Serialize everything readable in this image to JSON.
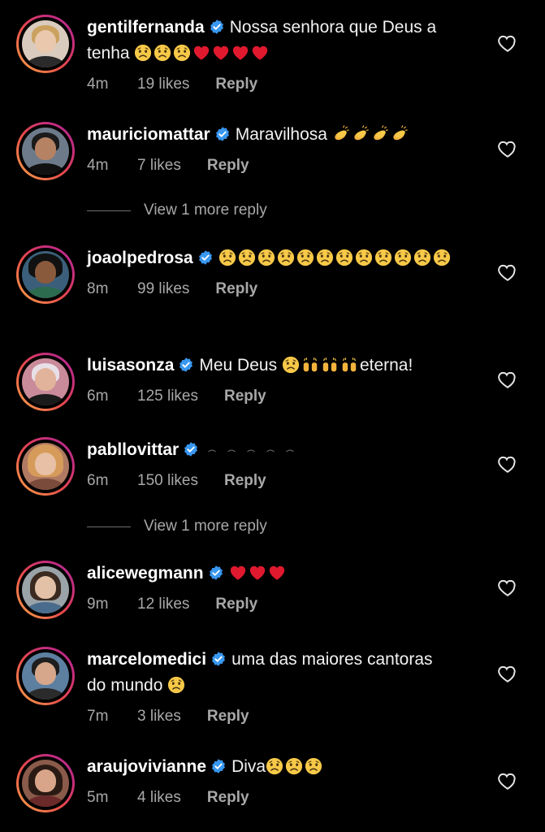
{
  "colors": {
    "background": "#000000",
    "text": "#f5f5f5",
    "meta": "#a8a8a8",
    "verified": "#3897f0",
    "heart_red": "#e0192e",
    "ring_gradient": [
      "#f9a94a",
      "#e8484b",
      "#c72d7d",
      "#b12a94"
    ]
  },
  "comments": [
    {
      "username": "gentilfernanda",
      "verified": true,
      "text_a": "Nossa senhora que Deus a",
      "text_b": "tenha",
      "emojis_after": [
        "sad-face-emoji",
        "sad-face-emoji",
        "sad-face-emoji",
        "red-heart-emoji",
        "red-heart-emoji",
        "red-heart-emoji",
        "red-heart-emoji"
      ],
      "time": "4m",
      "likes": "19 likes",
      "reply": "Reply",
      "avatar_icon": "avatar-photo"
    },
    {
      "username": "mauriciomattar",
      "verified": true,
      "text_a": "Maravilhosa",
      "emojis_after": [
        "clapping-hands-emoji",
        "clapping-hands-emoji",
        "clapping-hands-emoji",
        "clapping-hands-emoji"
      ],
      "time": "4m",
      "likes": "7 likes",
      "reply": "Reply",
      "avatar_icon": "avatar-photo"
    },
    {
      "username": "joaolpedrosa",
      "verified": true,
      "text_a": "",
      "emojis_after": [
        "sad-face-emoji",
        "sad-face-emoji",
        "sad-face-emoji",
        "sad-face-emoji",
        "sad-face-emoji",
        "sad-face-emoji",
        "sad-face-emoji",
        "sad-face-emoji",
        "sad-face-emoji",
        "sad-face-emoji",
        "sad-face-emoji",
        "sad-face-emoji"
      ],
      "time": "8m",
      "likes": "99 likes",
      "reply": "Reply",
      "avatar_icon": "avatar-photo"
    },
    {
      "username": "luisasonza",
      "verified": true,
      "text_a": "Meu Deus",
      "text_b": "eterna!",
      "emojis_after": [
        "sad-face-emoji",
        "raised-hands-emoji",
        "raised-hands-emoji",
        "raised-hands-emoji"
      ],
      "time": "6m",
      "likes": "125 likes",
      "reply": "Reply",
      "avatar_icon": "avatar-photo"
    },
    {
      "username": "pabllovittar",
      "verified": true,
      "text_a": "",
      "emojis_after": [
        "faded-emoji",
        "faded-emoji",
        "faded-emoji",
        "faded-emoji",
        "faded-emoji"
      ],
      "time": "6m",
      "likes": "150 likes",
      "reply": "Reply",
      "avatar_icon": "avatar-photo"
    },
    {
      "username": "alicewegmann",
      "verified": true,
      "text_a": "",
      "emojis_after": [
        "red-heart-emoji",
        "red-heart-emoji",
        "red-heart-emoji"
      ],
      "time": "9m",
      "likes": "12 likes",
      "reply": "Reply",
      "avatar_icon": "avatar-photo"
    },
    {
      "username": "marcelomedici",
      "verified": true,
      "text_a": "uma das maiores cantoras",
      "text_b": "do mundo",
      "emojis_after": [
        "sad-face-emoji"
      ],
      "time": "7m",
      "likes": "3 likes",
      "reply": "Reply",
      "avatar_icon": "avatar-photo"
    },
    {
      "username": "araujovivianne",
      "verified": true,
      "text_a": "Diva",
      "emojis_after": [
        "sad-face-emoji",
        "sad-face-emoji",
        "sad-face-emoji"
      ],
      "time": "5m",
      "likes": "4 likes",
      "reply": "Reply",
      "avatar_icon": "avatar-photo"
    }
  ],
  "view_more": [
    {
      "label": "View 1 more reply"
    },
    {
      "label": "View 1 more reply"
    }
  ]
}
